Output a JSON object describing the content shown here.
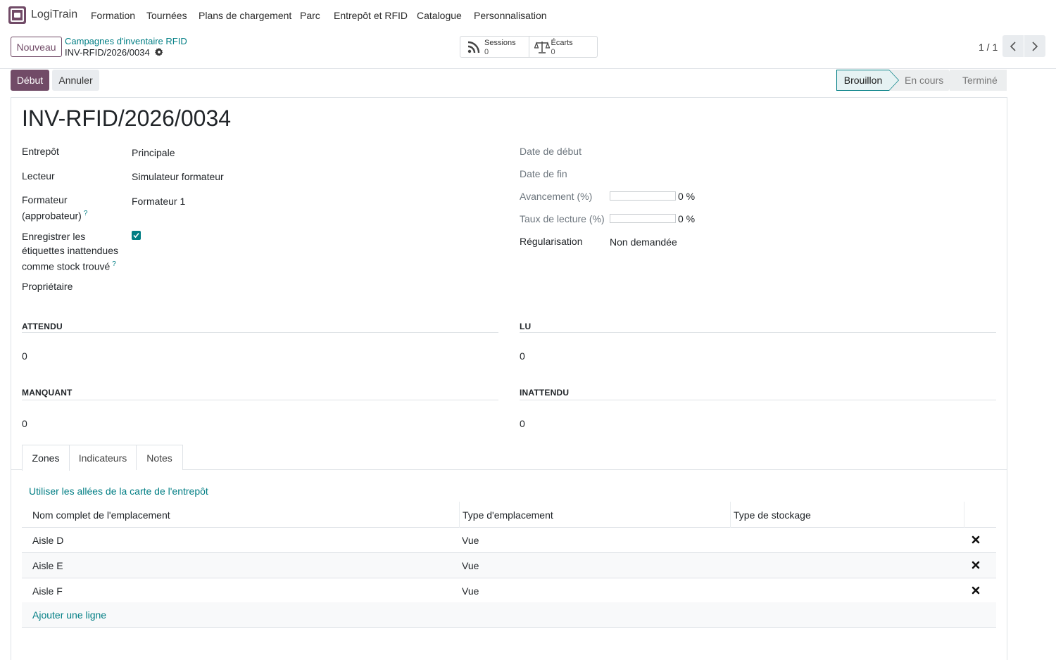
{
  "navbar": {
    "app_name": "LogiTrain",
    "menu": [
      "Formation",
      "Tournées",
      "Plans de chargement",
      "Parc",
      "Entrepôt et RFID",
      "Catalogue",
      "Personnalisation"
    ]
  },
  "control_panel": {
    "new_label": "Nouveau",
    "breadcrumb_parent": "Campagnes d'inventaire RFID",
    "breadcrumb_current": "INV-RFID/2026/0034",
    "smart_buttons": [
      {
        "label": "Sessions",
        "value": "0",
        "icon": "rss-icon"
      },
      {
        "label": "Écarts",
        "value": "0",
        "icon": "balance-scale-icon"
      }
    ],
    "pager": "1 / 1"
  },
  "statusbar": {
    "start_label": "Début",
    "cancel_label": "Annuler",
    "stages": [
      "Brouillon",
      "En cours",
      "Terminé"
    ],
    "active_stage": "Brouillon"
  },
  "record": {
    "title": "INV-RFID/2026/0034",
    "left_fields": {
      "warehouse_label": "Entrepôt",
      "warehouse_value": "Principale",
      "reader_label": "Lecteur",
      "reader_value": "Simulateur formateur",
      "trainer_label_1": "Formateur",
      "trainer_label_2": "(approbateur)",
      "trainer_value": "Formateur 1",
      "register_label_1": "Enregistrer les",
      "register_label_2": "étiquettes inattendues",
      "register_label_3": "comme stock trouvé",
      "register_checked": true,
      "owner_label": "Propriétaire",
      "help_mark": "?"
    },
    "right_fields": {
      "start_date_label": "Date de début",
      "end_date_label": "Date de fin",
      "progress_label": "Avancement (%)",
      "progress_value": "0 %",
      "progress_fraction": 0,
      "read_rate_label": "Taux de lecture (%)",
      "read_rate_value": "0 %",
      "read_rate_fraction": 0,
      "regularisation_label": "Régularisation",
      "regularisation_value": "Non demandée"
    },
    "counters": {
      "expected_title": "ATTENDU",
      "expected_value": "0",
      "read_title": "LU",
      "read_value": "0",
      "missing_title": "MANQUANT",
      "missing_value": "0",
      "unexpected_title": "INATTENDU",
      "unexpected_value": "0"
    }
  },
  "tabs": [
    "Zones",
    "Indicateurs",
    "Notes"
  ],
  "zones": {
    "map_link": "Utiliser les allées de la carte de l'entrepôt",
    "columns": [
      "Nom complet de l'emplacement",
      "Type d'emplacement",
      "Type de stockage"
    ],
    "rows": [
      {
        "name": "Aisle D",
        "type": "Vue",
        "storage": ""
      },
      {
        "name": "Aisle E",
        "type": "Vue",
        "storage": ""
      },
      {
        "name": "Aisle F",
        "type": "Vue",
        "storage": ""
      }
    ],
    "add_line": "Ajouter une ligne"
  },
  "colors": {
    "brand": "#714B67",
    "accent": "#017e84"
  }
}
